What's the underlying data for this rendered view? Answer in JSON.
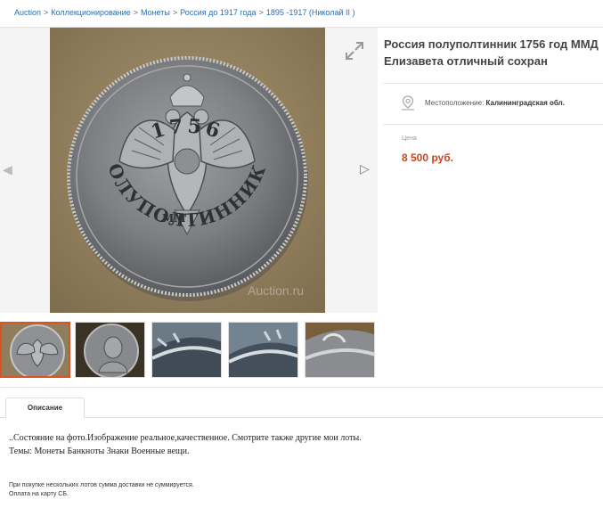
{
  "breadcrumb": {
    "items": [
      "Auction",
      "Коллекционирование",
      "Монеты",
      "Россия до 1917 года",
      "1895 -1917 (Николай II )"
    ],
    "separator": ">"
  },
  "gallery": {
    "watermark": "Auction.ru",
    "coin_legend": "ПОЛУПОЛТИННИКЪ",
    "coin_year": "1756",
    "coin_mint": "ММ",
    "thumbnails": [
      {
        "name": "reverse-eagle",
        "active": true
      },
      {
        "name": "obverse-portrait",
        "active": false
      },
      {
        "name": "edge-closeup-1",
        "active": false
      },
      {
        "name": "edge-closeup-2",
        "active": false
      },
      {
        "name": "edge-closeup-3",
        "active": false
      }
    ]
  },
  "lot": {
    "title": "Россия полуполтинник 1756 год ММД Елизавета отличный сохран",
    "location_label": "Местоположение:",
    "location_value": "Калининградская обл.",
    "price_label": "Цена",
    "price": "8 500 руб."
  },
  "tabs": {
    "description": "Описание"
  },
  "description": {
    "line1": "..Состояние на фото.Изображение реальное,качественное. Смотрите также другие мои лоты.",
    "line2": "Темы: Монеты Банкноты Знаки Военные вещи.",
    "note1": "При покупке нескольких лотов сумма доставки не суммируется.",
    "note2": "Оплата на карту СБ."
  },
  "colors": {
    "accent": "#d9541e",
    "price": "#c8461b",
    "link": "#2a6fb0"
  }
}
